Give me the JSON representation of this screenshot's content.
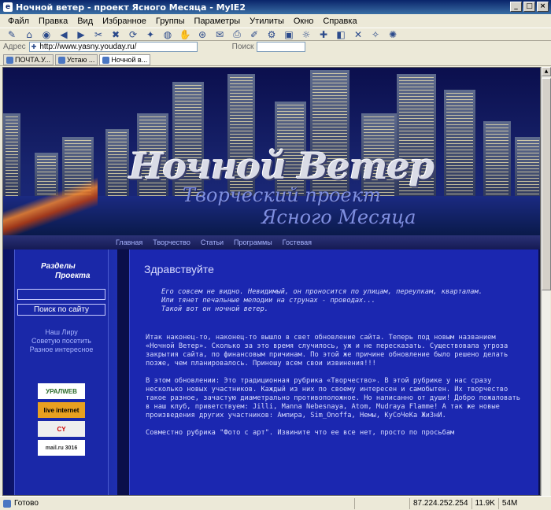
{
  "window": {
    "title": "Ночной ветер - проект Ясного Месяца - MyIE2",
    "app_icon": "browser-icon"
  },
  "menu": [
    "Файл",
    "Правка",
    "Вид",
    "Избранное",
    "Группы",
    "Параметры",
    "Утилиты",
    "Окно",
    "Справка"
  ],
  "address": {
    "label": "Адрес",
    "url": "http://www.yasny.youday.ru/",
    "search_label": "Поиск"
  },
  "tabs": [
    {
      "label": "ПОЧТА.У...",
      "active": false
    },
    {
      "label": "Устаю ...",
      "active": false
    },
    {
      "label": "Ночной в...",
      "active": true
    }
  ],
  "site": {
    "logo": "Ночной Ветер",
    "subtitle_line1": "Творческий проект",
    "subtitle_line2": "Ясного Месяца",
    "nav": [
      "Главная",
      "Творчество",
      "Статьи",
      "Программы",
      "Гостевая"
    ],
    "sidebar": {
      "title_line1": "Разделы",
      "title_line2": "Проекта",
      "search_button": "Поиск по сайту",
      "links": [
        "Наш Лиру",
        "Советую посетить",
        "Разное интересное"
      ],
      "counters": [
        "УРАЛWEB",
        "live internet",
        "CY",
        "mail.ru 3016"
      ]
    },
    "content": {
      "title": "Здравствуйте",
      "poem": [
        "Его совсем не видно. Невидимый, он проносится по улицам, переулкам, кварталам.",
        "Или тянет печальные мелодии на струнах - проводах...",
        "Такой вот он ночной ветер."
      ],
      "paragraphs": [
        "Итак наконец-то, наконец-то вышло в свет обновление сайта. Теперь под новым названием «Ночной Ветер». Сколько за это время случилось, уж и не пересказать. Существовала угроза закрытия сайта, по финансовым причинам. По этой же причине обновление было решено делать позже, чем планировалось. Приношу всем свои извинения!!!",
        "В этом обновлении: Это традиционная рубрика «Творчество». В этой рубрике у нас сразу несколько новых участников. Каждый из них по своему интересен и самобытен. Их творчество такое разное, зачастую диаметрально противоположное. Но написанно от души! Добро пожаловать в наш клуб, приветствуем: Jilli, Manna Nebesnaya, Atom, Mudraya Flamme! А так же новые произведения других участников: Ампира, Sim_Onoffa, Немы, КуСоЧеКа ЖиЗнИ.",
        "Совместно рубрика \"Фото с арт\". Извините что ее все нет, просто по просьбам"
      ]
    }
  },
  "status": {
    "text": "Готово",
    "ip": "87.224.252.254",
    "size": "11.9K",
    "mem": "54M"
  }
}
